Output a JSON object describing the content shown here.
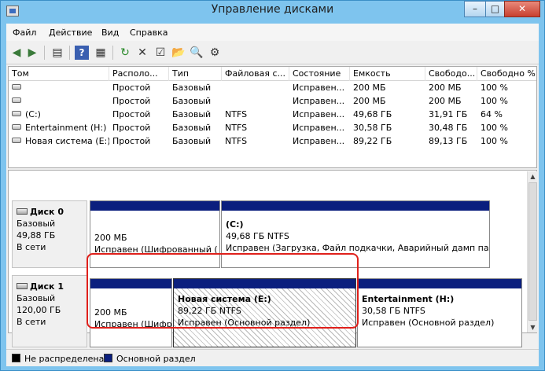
{
  "window": {
    "title": "Управление дисками"
  },
  "menu": [
    "Файл",
    "Действие",
    "Вид",
    "Справка"
  ],
  "toolbar": [
    "back-icon",
    "forward-icon",
    "properties-icon",
    "help-icon",
    "view-icon",
    "refresh-icon",
    "delete-icon",
    "check-icon",
    "open-icon",
    "find-icon",
    "settings-icon"
  ],
  "volumes": {
    "columns": [
      "Том",
      "Располо...",
      "Тип",
      "Файловая с...",
      "Состояние",
      "Емкость",
      "Свободо...",
      "Свободно %"
    ],
    "rows": [
      [
        "",
        "Простой",
        "Базовый",
        "",
        "Исправен...",
        "200 МБ",
        "200 МБ",
        "100 %"
      ],
      [
        "",
        "Простой",
        "Базовый",
        "",
        "Исправен...",
        "200 МБ",
        "200 МБ",
        "100 %"
      ],
      [
        "(C:)",
        "Простой",
        "Базовый",
        "NTFS",
        "Исправен...",
        "49,68 ГБ",
        "31,91 ГБ",
        "64 %"
      ],
      [
        "Entertainment (H:)",
        "Простой",
        "Базовый",
        "NTFS",
        "Исправен...",
        "30,58 ГБ",
        "30,48 ГБ",
        "100 %"
      ],
      [
        "Новая система (E:)",
        "Простой",
        "Базовый",
        "NTFS",
        "Исправен...",
        "89,22 ГБ",
        "89,13 ГБ",
        "100 %"
      ]
    ]
  },
  "disks": [
    {
      "name": "Диск 0",
      "type": "Базовый",
      "size": "49,88 ГБ",
      "status": "В сети",
      "partitions": [
        {
          "title": "",
          "size": "200 МБ",
          "status": "Исправен (Шифрованный ("
        },
        {
          "title": "(C:)",
          "size": "49,68 ГБ NTFS",
          "status": "Исправен (Загрузка, Файл подкачки, Аварийный дамп пам"
        }
      ]
    },
    {
      "name": "Диск 1",
      "type": "Базовый",
      "size": "120,00 ГБ",
      "status": "В сети",
      "partitions": [
        {
          "title": "",
          "size": "200 МБ",
          "status": "Исправен (Шифр"
        },
        {
          "title": "Новая система  (E:)",
          "size": "89,22 ГБ NTFS",
          "status": "Исправен (Основной раздел)"
        },
        {
          "title": "Entertainment  (H:)",
          "size": "30,58 ГБ NTFS",
          "status": "Исправен (Основной раздел)"
        }
      ]
    }
  ],
  "legend": [
    {
      "label": "Не распределена",
      "color": "#000000"
    },
    {
      "label": "Основной раздел",
      "color": "#0b1f7e"
    }
  ]
}
